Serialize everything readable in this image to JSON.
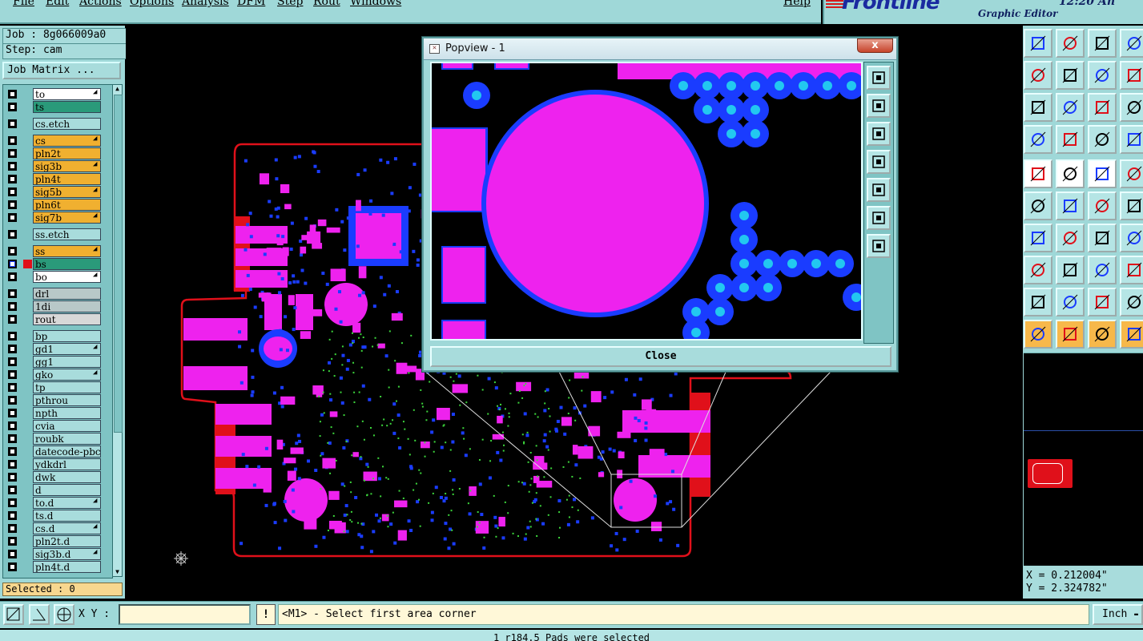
{
  "menu": [
    "File",
    "Edit",
    "Actions",
    "Options",
    "Analysis",
    "DFM",
    "Step",
    "Rout",
    "Windows"
  ],
  "help_label": "Help",
  "brand": {
    "logo": "Frontline",
    "subtitle": "Graphic Editor",
    "time": "12:20 An"
  },
  "job": {
    "job_label": "Job : 8g066009a0",
    "step_label": "Step: cam",
    "matrix_button": "Job Matrix ..."
  },
  "layers": [
    {
      "name": "to",
      "color": "#ffffff",
      "arrow": true
    },
    {
      "name": "ts",
      "color": "#2a9a7a",
      "arrow": false
    },
    {
      "name": "cs.etch",
      "color": "#a8dcdc",
      "arrow": false,
      "gap": true
    },
    {
      "name": "cs",
      "color": "#f0b030",
      "arrow": true,
      "gap": true
    },
    {
      "name": "pln2t",
      "color": "#f0b030",
      "arrow": false
    },
    {
      "name": "sig3b",
      "color": "#f0b030",
      "arrow": true
    },
    {
      "name": "pln4t",
      "color": "#f0b030",
      "arrow": false
    },
    {
      "name": "sig5b",
      "color": "#f0b030",
      "arrow": true
    },
    {
      "name": "pln6t",
      "color": "#f0b030",
      "arrow": false
    },
    {
      "name": "sig7b",
      "color": "#f0b030",
      "arrow": true
    },
    {
      "name": "ss.etch",
      "color": "#a8dcdc",
      "arrow": false,
      "gap": true
    },
    {
      "name": "ss",
      "color": "#f0b030",
      "arrow": true,
      "gap": true
    },
    {
      "name": "bs",
      "color": "#2a9a7a",
      "arrow": false,
      "active": true
    },
    {
      "name": "bo",
      "color": "#ffffff",
      "arrow": true
    },
    {
      "name": "drl",
      "color": "#b8c8c8",
      "arrow": false,
      "gap": true
    },
    {
      "name": "1di",
      "color": "#b8c8c8",
      "arrow": false
    },
    {
      "name": "rout",
      "color": "#d8d8d8",
      "arrow": false
    },
    {
      "name": "bp",
      "color": "#a8dcdc",
      "arrow": false,
      "gap": true
    },
    {
      "name": "gd1",
      "color": "#a8dcdc",
      "arrow": true
    },
    {
      "name": "gg1",
      "color": "#a8dcdc",
      "arrow": false
    },
    {
      "name": "gko",
      "color": "#a8dcdc",
      "arrow": true
    },
    {
      "name": "tp",
      "color": "#a8dcdc",
      "arrow": false
    },
    {
      "name": "pthrou",
      "color": "#a8dcdc",
      "arrow": false
    },
    {
      "name": "npth",
      "color": "#a8dcdc",
      "arrow": false
    },
    {
      "name": "cvia",
      "color": "#a8dcdc",
      "arrow": false
    },
    {
      "name": "roubk",
      "color": "#a8dcdc",
      "arrow": false
    },
    {
      "name": "datecode-pbc",
      "color": "#a8dcdc",
      "arrow": false
    },
    {
      "name": "ydkdrl",
      "color": "#a8dcdc",
      "arrow": false
    },
    {
      "name": "dwk",
      "color": "#a8dcdc",
      "arrow": false
    },
    {
      "name": "d",
      "color": "#a8dcdc",
      "arrow": false
    },
    {
      "name": "to.d",
      "color": "#a8dcdc",
      "arrow": true
    },
    {
      "name": "ts.d",
      "color": "#a8dcdc",
      "arrow": false
    },
    {
      "name": "cs.d",
      "color": "#a8dcdc",
      "arrow": true
    },
    {
      "name": "pln2t.d",
      "color": "#a8dcdc",
      "arrow": false
    },
    {
      "name": "sig3b.d",
      "color": "#a8dcdc",
      "arrow": true
    },
    {
      "name": "pln4t.d",
      "color": "#a8dcdc",
      "arrow": false
    }
  ],
  "selected_label": "Selected : 0",
  "popview": {
    "title": "Popview - 1",
    "close_x": "x",
    "close_button": "Close"
  },
  "coords": {
    "x": "X = 0.212004\"",
    "y": "Y = 2.324782\""
  },
  "bottom": {
    "xy_label": "X Y :",
    "xy_value": "",
    "bang": "!",
    "prompt": "<M1> - Select first area corner",
    "units": "Inch"
  },
  "status": "1 r184.5 Pads were selected",
  "colors": {
    "panel": "#9fd8d8",
    "pad": "#ee22ee",
    "via": "#1a3cff",
    "outline": "#e0101a",
    "drill": "#22c8f0"
  }
}
